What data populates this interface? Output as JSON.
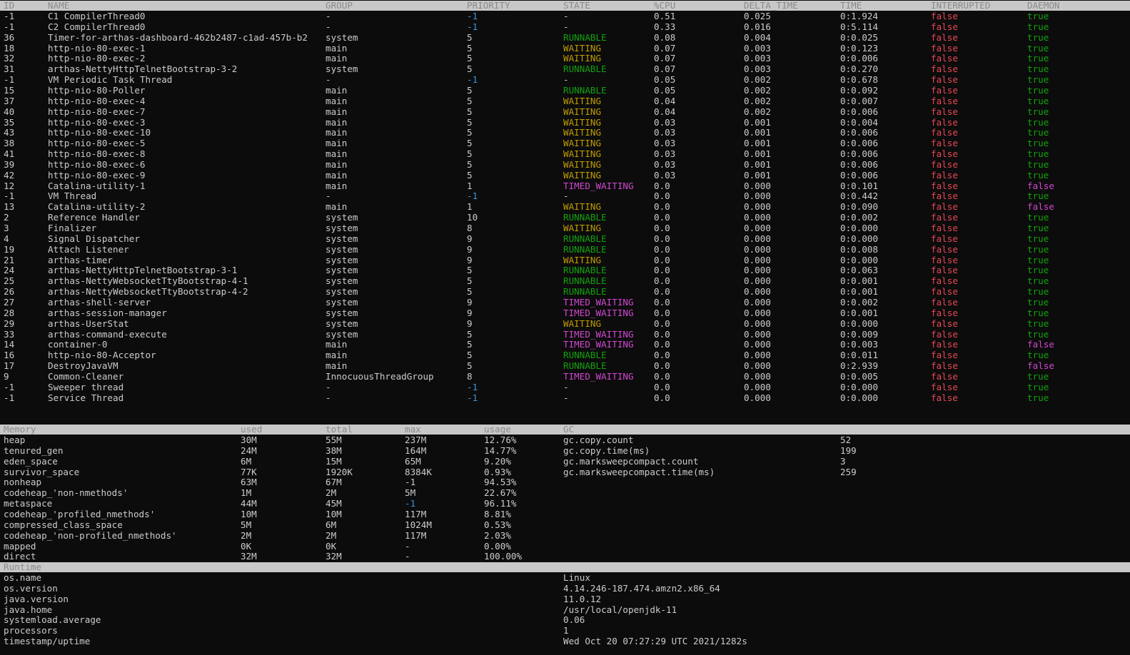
{
  "thread_headers": {
    "id": "ID",
    "name": "NAME",
    "group": "GROUP",
    "priority": "PRIORITY",
    "state": "STATE",
    "cpu": "%CPU",
    "delta": "DELTA_TIME",
    "time": "TIME",
    "interrupted": "INTERRUPTED",
    "daemon": "DAEMON"
  },
  "threads": [
    [
      "-1",
      "C1 CompilerThread0",
      "-",
      "-1",
      "-",
      "0.51",
      "0.025",
      "0:1.924",
      "false",
      "true"
    ],
    [
      "-1",
      "C2 CompilerThread0",
      "-",
      "-1",
      "-",
      "0.33",
      "0.016",
      "0:5.114",
      "false",
      "true"
    ],
    [
      "36",
      "Timer-for-arthas-dashboard-462b2487-c1ad-457b-b2",
      "system",
      "5",
      "RUNNABLE",
      "0.08",
      "0.004",
      "0:0.025",
      "false",
      "true"
    ],
    [
      "18",
      "http-nio-80-exec-1",
      "main",
      "5",
      "WAITING",
      "0.07",
      "0.003",
      "0:0.123",
      "false",
      "true"
    ],
    [
      "32",
      "http-nio-80-exec-2",
      "main",
      "5",
      "WAITING",
      "0.07",
      "0.003",
      "0:0.006",
      "false",
      "true"
    ],
    [
      "31",
      "arthas-NettyHttpTelnetBootstrap-3-2",
      "system",
      "5",
      "RUNNABLE",
      "0.07",
      "0.003",
      "0:0.270",
      "false",
      "true"
    ],
    [
      "-1",
      "VM Periodic Task Thread",
      "-",
      "-1",
      "-",
      "0.05",
      "0.002",
      "0:0.678",
      "false",
      "true"
    ],
    [
      "15",
      "http-nio-80-Poller",
      "main",
      "5",
      "RUNNABLE",
      "0.05",
      "0.002",
      "0:0.092",
      "false",
      "true"
    ],
    [
      "37",
      "http-nio-80-exec-4",
      "main",
      "5",
      "WAITING",
      "0.04",
      "0.002",
      "0:0.007",
      "false",
      "true"
    ],
    [
      "40",
      "http-nio-80-exec-7",
      "main",
      "5",
      "WAITING",
      "0.04",
      "0.002",
      "0:0.006",
      "false",
      "true"
    ],
    [
      "35",
      "http-nio-80-exec-3",
      "main",
      "5",
      "WAITING",
      "0.03",
      "0.001",
      "0:0.004",
      "false",
      "true"
    ],
    [
      "43",
      "http-nio-80-exec-10",
      "main",
      "5",
      "WAITING",
      "0.03",
      "0.001",
      "0:0.006",
      "false",
      "true"
    ],
    [
      "38",
      "http-nio-80-exec-5",
      "main",
      "5",
      "WAITING",
      "0.03",
      "0.001",
      "0:0.006",
      "false",
      "true"
    ],
    [
      "41",
      "http-nio-80-exec-8",
      "main",
      "5",
      "WAITING",
      "0.03",
      "0.001",
      "0:0.006",
      "false",
      "true"
    ],
    [
      "39",
      "http-nio-80-exec-6",
      "main",
      "5",
      "WAITING",
      "0.03",
      "0.001",
      "0:0.006",
      "false",
      "true"
    ],
    [
      "42",
      "http-nio-80-exec-9",
      "main",
      "5",
      "WAITING",
      "0.03",
      "0.001",
      "0:0.006",
      "false",
      "true"
    ],
    [
      "12",
      "Catalina-utility-1",
      "main",
      "1",
      "TIMED_WAITING",
      "0.0",
      "0.000",
      "0:0.101",
      "false",
      "false"
    ],
    [
      "-1",
      "VM Thread",
      "-",
      "-1",
      "-",
      "0.0",
      "0.000",
      "0:0.442",
      "false",
      "true"
    ],
    [
      "13",
      "Catalina-utility-2",
      "main",
      "1",
      "WAITING",
      "0.0",
      "0.000",
      "0:0.090",
      "false",
      "false"
    ],
    [
      "2",
      "Reference Handler",
      "system",
      "10",
      "RUNNABLE",
      "0.0",
      "0.000",
      "0:0.002",
      "false",
      "true"
    ],
    [
      "3",
      "Finalizer",
      "system",
      "8",
      "WAITING",
      "0.0",
      "0.000",
      "0:0.000",
      "false",
      "true"
    ],
    [
      "4",
      "Signal Dispatcher",
      "system",
      "9",
      "RUNNABLE",
      "0.0",
      "0.000",
      "0:0.000",
      "false",
      "true"
    ],
    [
      "19",
      "Attach Listener",
      "system",
      "9",
      "RUNNABLE",
      "0.0",
      "0.000",
      "0:0.008",
      "false",
      "true"
    ],
    [
      "21",
      "arthas-timer",
      "system",
      "9",
      "WAITING",
      "0.0",
      "0.000",
      "0:0.000",
      "false",
      "true"
    ],
    [
      "24",
      "arthas-NettyHttpTelnetBootstrap-3-1",
      "system",
      "5",
      "RUNNABLE",
      "0.0",
      "0.000",
      "0:0.063",
      "false",
      "true"
    ],
    [
      "25",
      "arthas-NettyWebsocketTtyBootstrap-4-1",
      "system",
      "5",
      "RUNNABLE",
      "0.0",
      "0.000",
      "0:0.001",
      "false",
      "true"
    ],
    [
      "26",
      "arthas-NettyWebsocketTtyBootstrap-4-2",
      "system",
      "5",
      "RUNNABLE",
      "0.0",
      "0.000",
      "0:0.001",
      "false",
      "true"
    ],
    [
      "27",
      "arthas-shell-server",
      "system",
      "9",
      "TIMED_WAITING",
      "0.0",
      "0.000",
      "0:0.002",
      "false",
      "true"
    ],
    [
      "28",
      "arthas-session-manager",
      "system",
      "9",
      "TIMED_WAITING",
      "0.0",
      "0.000",
      "0:0.001",
      "false",
      "true"
    ],
    [
      "29",
      "arthas-UserStat",
      "system",
      "9",
      "WAITING",
      "0.0",
      "0.000",
      "0:0.000",
      "false",
      "true"
    ],
    [
      "33",
      "arthas-command-execute",
      "system",
      "5",
      "TIMED_WAITING",
      "0.0",
      "0.000",
      "0:0.009",
      "false",
      "true"
    ],
    [
      "14",
      "container-0",
      "main",
      "5",
      "TIMED_WAITING",
      "0.0",
      "0.000",
      "0:0.003",
      "false",
      "false"
    ],
    [
      "16",
      "http-nio-80-Acceptor",
      "main",
      "5",
      "RUNNABLE",
      "0.0",
      "0.000",
      "0:0.011",
      "false",
      "true"
    ],
    [
      "17",
      "DestroyJavaVM",
      "main",
      "5",
      "RUNNABLE",
      "0.0",
      "0.000",
      "0:2.939",
      "false",
      "false"
    ],
    [
      "9",
      "Common-Cleaner",
      "InnocuousThreadGroup",
      "8",
      "TIMED_WAITING",
      "0.0",
      "0.000",
      "0:0.005",
      "false",
      "true"
    ],
    [
      "-1",
      "Sweeper thread",
      "-",
      "-1",
      "-",
      "0.0",
      "0.000",
      "0:0.000",
      "false",
      "true"
    ],
    [
      "-1",
      "Service Thread",
      "-",
      "-1",
      "-",
      "0.0",
      "0.000",
      "0:0.000",
      "false",
      "true"
    ]
  ],
  "memory_headers": {
    "memory": "Memory",
    "used": "used",
    "total": "total",
    "max": "max",
    "usage": "usage",
    "gc": "GC"
  },
  "memory": [
    [
      "heap",
      "30M",
      "55M",
      "237M",
      "12.76%"
    ],
    [
      "tenured_gen",
      "24M",
      "38M",
      "164M",
      "14.77%"
    ],
    [
      "eden_space",
      "6M",
      "15M",
      "65M",
      "9.20%"
    ],
    [
      "survivor_space",
      "77K",
      "1920K",
      "8384K",
      "0.93%"
    ],
    [
      "nonheap",
      "63M",
      "67M",
      "-1",
      "94.53%"
    ],
    [
      "codeheap_'non-nmethods'",
      "1M",
      "2M",
      "5M",
      "22.67%"
    ],
    [
      "metaspace",
      "44M",
      "45M",
      "-1",
      "96.11%"
    ],
    [
      "codeheap_'profiled_nmethods'",
      "10M",
      "10M",
      "117M",
      "8.81%"
    ],
    [
      "compressed_class_space",
      "5M",
      "6M",
      "1024M",
      "0.53%"
    ],
    [
      "codeheap_'non-profiled_nmethods'",
      "2M",
      "2M",
      "117M",
      "2.03%"
    ],
    [
      "mapped",
      "0K",
      "0K",
      "-",
      "0.00%"
    ],
    [
      "direct",
      "32M",
      "32M",
      "-",
      "100.00%"
    ]
  ],
  "gc": [
    [
      "gc.copy.count",
      "52"
    ],
    [
      "gc.copy.time(ms)",
      "199"
    ],
    [
      "gc.marksweepcompact.count",
      "3"
    ],
    [
      "gc.marksweepcompact.time(ms)",
      "259"
    ]
  ],
  "runtime_header": "Runtime",
  "runtime": [
    [
      "os.name",
      "Linux"
    ],
    [
      "os.version",
      "4.14.246-187.474.amzn2.x86_64"
    ],
    [
      "java.version",
      "11.0.12"
    ],
    [
      "java.home",
      "/usr/local/openjdk-11"
    ],
    [
      "systemload.average",
      "0.06"
    ],
    [
      "processors",
      "1"
    ],
    [
      "timestamp/uptime",
      "Wed Oct 20 07:27:29 UTC 2021/1282s"
    ]
  ]
}
